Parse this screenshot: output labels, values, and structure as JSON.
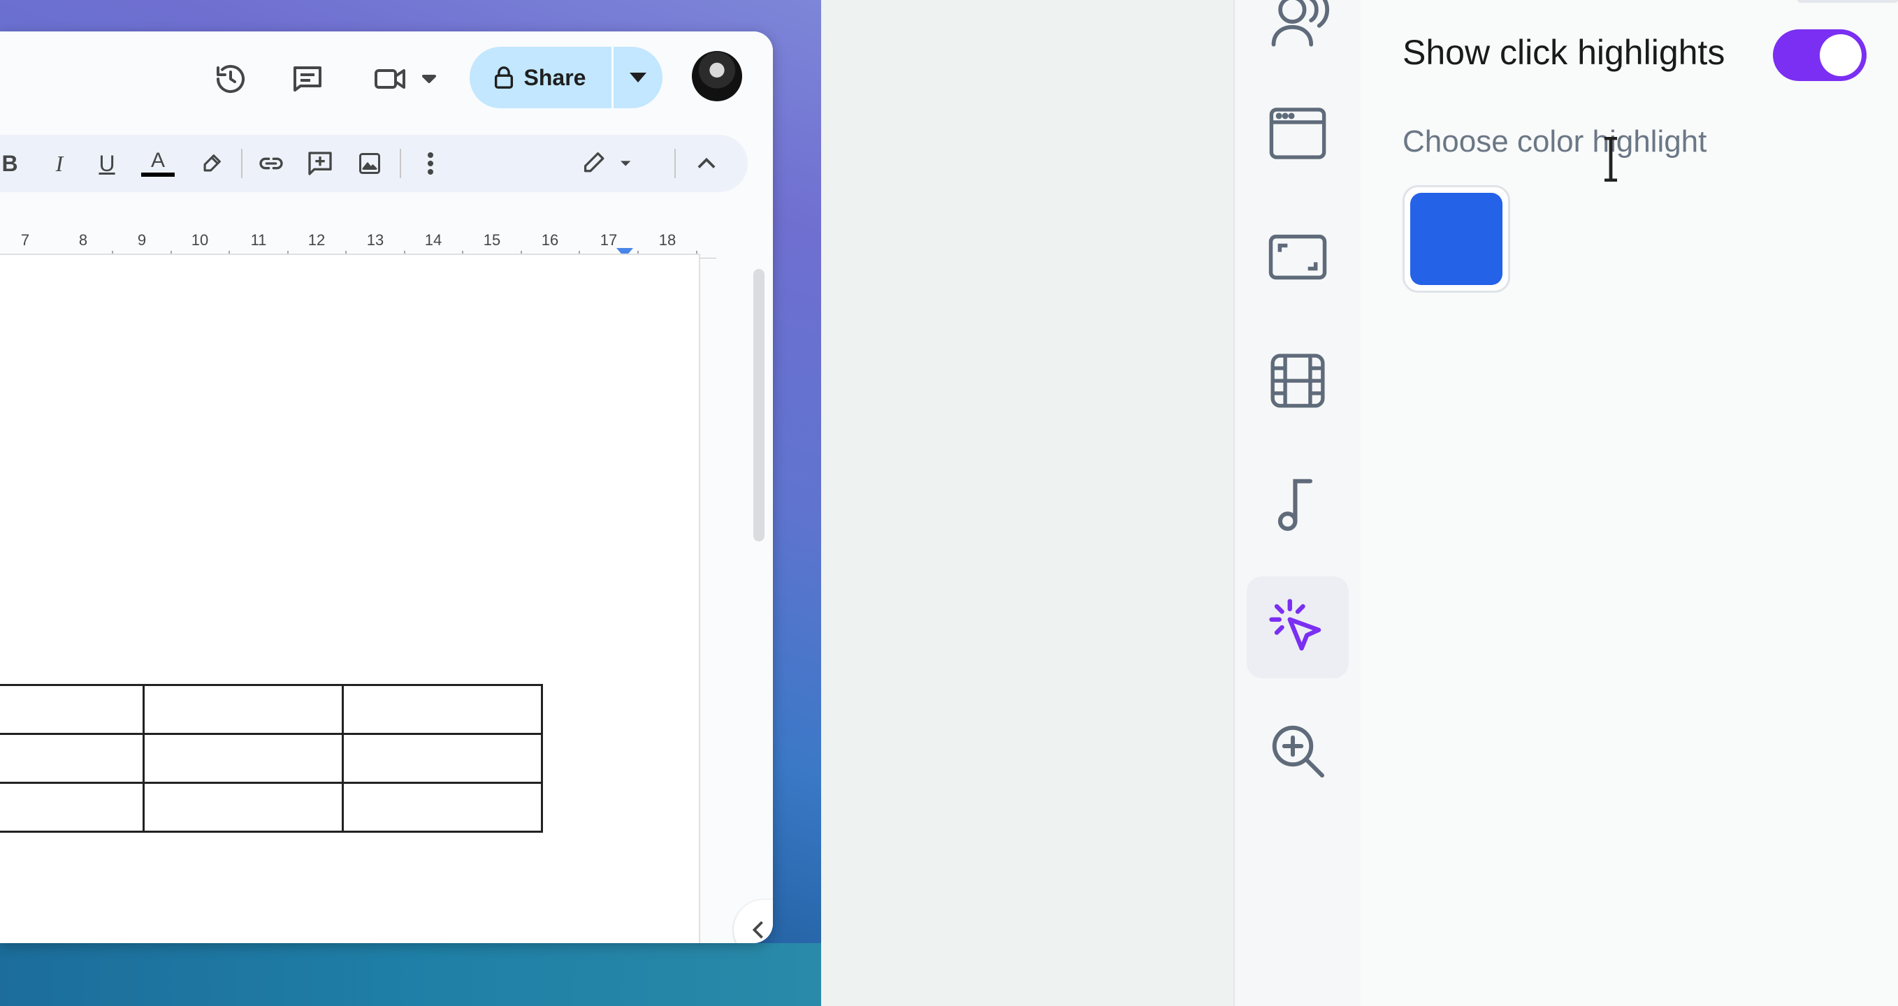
{
  "docs": {
    "share_label": "Share",
    "ruler_numbers": [
      "7",
      "8",
      "9",
      "10",
      "11",
      "12",
      "13",
      "14",
      "15",
      "16",
      "17",
      "18"
    ],
    "toolbar": {
      "bold": "B",
      "italic": "I",
      "underline": "U",
      "text_color": "A"
    }
  },
  "settings": {
    "show_click_highlights_label": "Show click highlights",
    "show_click_highlights_enabled": true,
    "choose_color_label": "Choose color highlight",
    "highlight_color": "#2462e8",
    "toggle_color": "#7a2ff2"
  },
  "rail": {
    "icons": [
      "voice-icon",
      "browser-window-icon",
      "screen-area-icon",
      "film-icon",
      "music-note-icon",
      "click-highlight-icon",
      "zoom-in-icon"
    ],
    "active": "click-highlight-icon"
  }
}
